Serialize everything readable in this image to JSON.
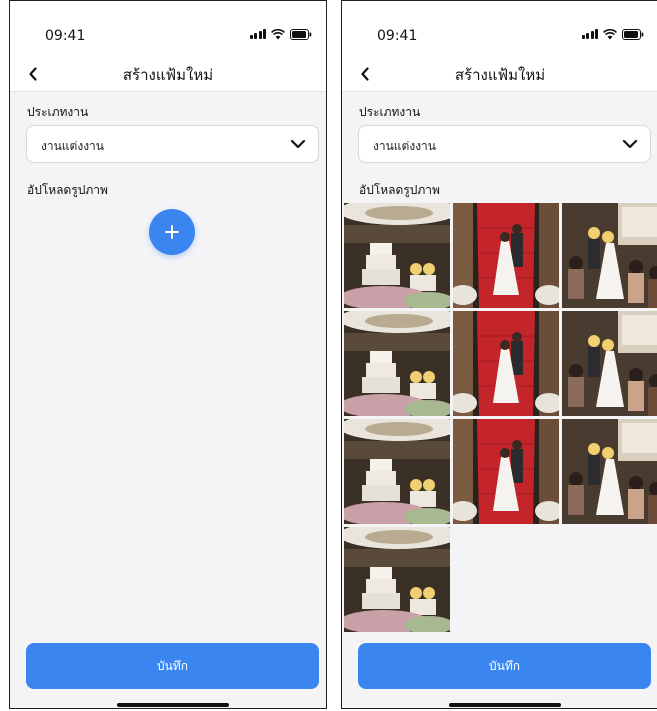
{
  "colors": {
    "accent": "#3a85ef",
    "background": "#f4f4f6",
    "header": "#ffffff"
  },
  "screens": [
    {
      "id": "empty",
      "status": {
        "time": "09:41",
        "icons": [
          "signal-icon",
          "wifi-icon",
          "battery-icon"
        ]
      },
      "nav": {
        "title": "สร้างแฟ้มใหม่",
        "back_icon": "chevron-left-icon"
      },
      "form": {
        "type_label": "ประเภทงาน",
        "type_value": "งานแต่งงาน",
        "upload_label": "อัปโหลดรูปภาพ",
        "photos": []
      },
      "save_label": "บันทึก"
    },
    {
      "id": "with-photos",
      "status": {
        "time": "09:41",
        "icons": [
          "signal-icon",
          "wifi-icon",
          "battery-icon"
        ]
      },
      "nav": {
        "title": "สร้างแฟ้มใหม่",
        "back_icon": "chevron-left-icon"
      },
      "form": {
        "type_label": "ประเภทงาน",
        "type_value": "งานแต่งงาน",
        "upload_label": "อัปโหลดรูปภาพ",
        "photos": [
          "wedding-cake-photo",
          "red-stairs-couple-photo",
          "bride-guests-photo",
          "wedding-cake-photo",
          "red-stairs-couple-photo",
          "bride-guests-photo",
          "wedding-cake-photo",
          "red-stairs-couple-photo",
          "bride-guests-photo",
          "wedding-cake-photo"
        ]
      },
      "save_label": "บันทึก"
    }
  ]
}
